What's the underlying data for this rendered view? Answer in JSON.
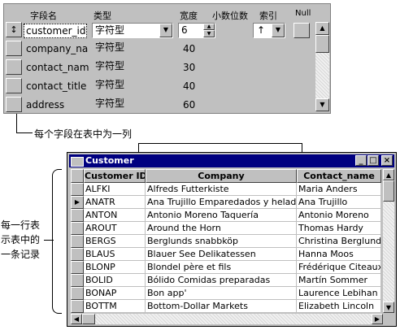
{
  "designer": {
    "headers": {
      "field_name": "字段名",
      "type": "类型",
      "width": "宽度",
      "decimals": "小数位数",
      "index": "索引",
      "null": "Null"
    },
    "rows": [
      {
        "selector": "↕",
        "name": "customer_id",
        "type": "字符型",
        "width": "6"
      },
      {
        "selector": "",
        "name": "company_na",
        "type": "字符型",
        "width": "40"
      },
      {
        "selector": "",
        "name": "contact_nam",
        "type": "字符型",
        "width": "30"
      },
      {
        "selector": "",
        "name": "contact_title",
        "type": "字符型",
        "width": "40"
      },
      {
        "selector": "",
        "name": "address",
        "type": "字符型",
        "width": "60"
      }
    ]
  },
  "callouts": {
    "field_column": "每个字段在表中为一列",
    "record_row": "每一行表示表中的一条记录"
  },
  "window": {
    "title": "Customer",
    "columns": [
      "Customer ID",
      "Company",
      "Contact_name"
    ],
    "rows": [
      [
        "ALFKI",
        "Alfreds Futterkiste",
        "Maria Anders"
      ],
      [
        "ANATR",
        "Ana Trujillo Emparedados y helados",
        "Ana Trujillo"
      ],
      [
        "ANTON",
        "Antonio Moreno Taquería",
        "Antonio Moreno"
      ],
      [
        "AROUT",
        "Around the Horn",
        "Thomas Hardy"
      ],
      [
        "BERGS",
        "Berglunds snabbköp",
        "Christina Berglund"
      ],
      [
        "BLAUS",
        "Blauer See Delikatessen",
        "Hanna Moos"
      ],
      [
        "BLONP",
        "Blondel père et fils",
        "Frédérique Citeaux"
      ],
      [
        "BOLID",
        "Bólido Comidas preparadas",
        "Martín Sommer"
      ],
      [
        "BONAP",
        "Bon app'",
        "Laurence Lebihan"
      ],
      [
        "BOTTM",
        "Bottom-Dollar Markets",
        "Elizabeth Lincoln"
      ]
    ],
    "current_row_marker": "▶"
  }
}
